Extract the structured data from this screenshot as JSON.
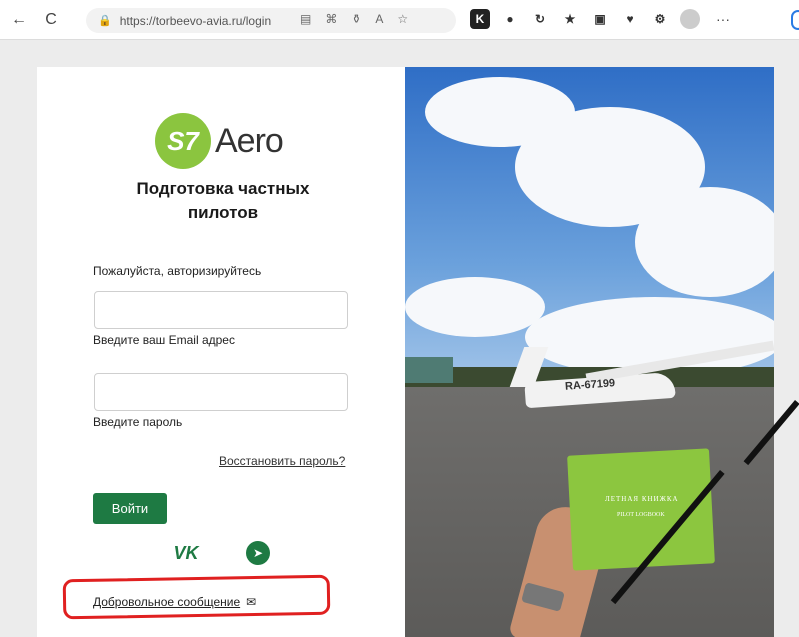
{
  "browser": {
    "url": "https://torbeevo-avia.ru/login",
    "back_icon": "←",
    "reload_icon": "C",
    "more_label": "···",
    "ext_k_label": "K"
  },
  "logo": {
    "mark": "S7",
    "text": "Aero",
    "brand_color": "#8bc53f"
  },
  "login": {
    "title": "Подготовка частных пилотов",
    "prompt": "Пожалуйста, авторизируйтесь",
    "email_value": "",
    "email_hint": "Введите ваш Email адрес",
    "password_value": "",
    "password_hint": "Введите пароль",
    "forgot_label": "Восстановить пароль?",
    "submit_label": "Войти",
    "submit_color": "#1e7a43"
  },
  "social": {
    "vk_label": "VK"
  },
  "footer": {
    "voluntary_label": "Добровольное сообщение"
  },
  "photo": {
    "registration": "RA-67199",
    "book_title": "ЛЕТНАЯ КНИЖКА",
    "book_subtitle": "PILOT LOGBOOK"
  }
}
